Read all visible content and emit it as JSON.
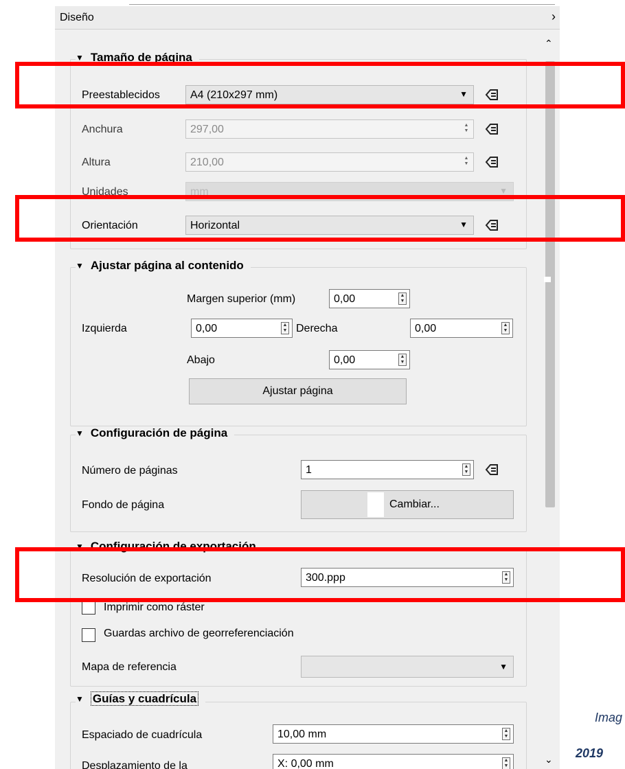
{
  "panel": {
    "title": "Diseño",
    "close_icon": "close-icon"
  },
  "page_size": {
    "title": "Tamaño de página",
    "preset_label": "Preestablecidos",
    "preset_value": "A4 (210x297 mm)",
    "width_label": "Anchura",
    "width_value": "297,00",
    "height_label": "Altura",
    "height_value": "210,00",
    "units_label": "Unidades",
    "units_value": "mm",
    "orientation_label": "Orientación",
    "orientation_value": "Horizontal"
  },
  "fit_page": {
    "title": "Ajustar página al contenido",
    "top_margin_label": "Margen superior (mm)",
    "top_margin_value": "0,00",
    "left_label": "Izquierda",
    "left_value": "0,00",
    "right_label": "Derecha",
    "right_value": "0,00",
    "bottom_label": "Abajo",
    "bottom_value": "0,00",
    "fit_button": "Ajustar página"
  },
  "page_config": {
    "title": "Configuración de página",
    "num_pages_label": "Número de páginas",
    "num_pages_value": "1",
    "background_label": "Fondo de página",
    "change_button": "Cambiar..."
  },
  "export_config": {
    "title": "Configuración de exportación",
    "resolution_label": "Resolución de exportación",
    "resolution_value": "300.ppp",
    "print_raster_label": "Imprimir como ráster",
    "print_raster_checked": false,
    "georef_label": "Guardas archivo de georreferenciación",
    "georef_checked": false,
    "ref_map_label": "Mapa de referencia",
    "ref_map_value": ""
  },
  "guides": {
    "title": "Guías y cuadrícula",
    "spacing_label": "Espaciado de cuadrícula",
    "spacing_value": "10,00 mm",
    "offset_label": "Desplazamiento de la",
    "offset_value": "X: 0,00 mm"
  },
  "caption": {
    "line1": "Imag",
    "line2": "2019"
  },
  "colors": {
    "highlight": "#ff0000",
    "panel_bg": "#f0f0f0"
  }
}
